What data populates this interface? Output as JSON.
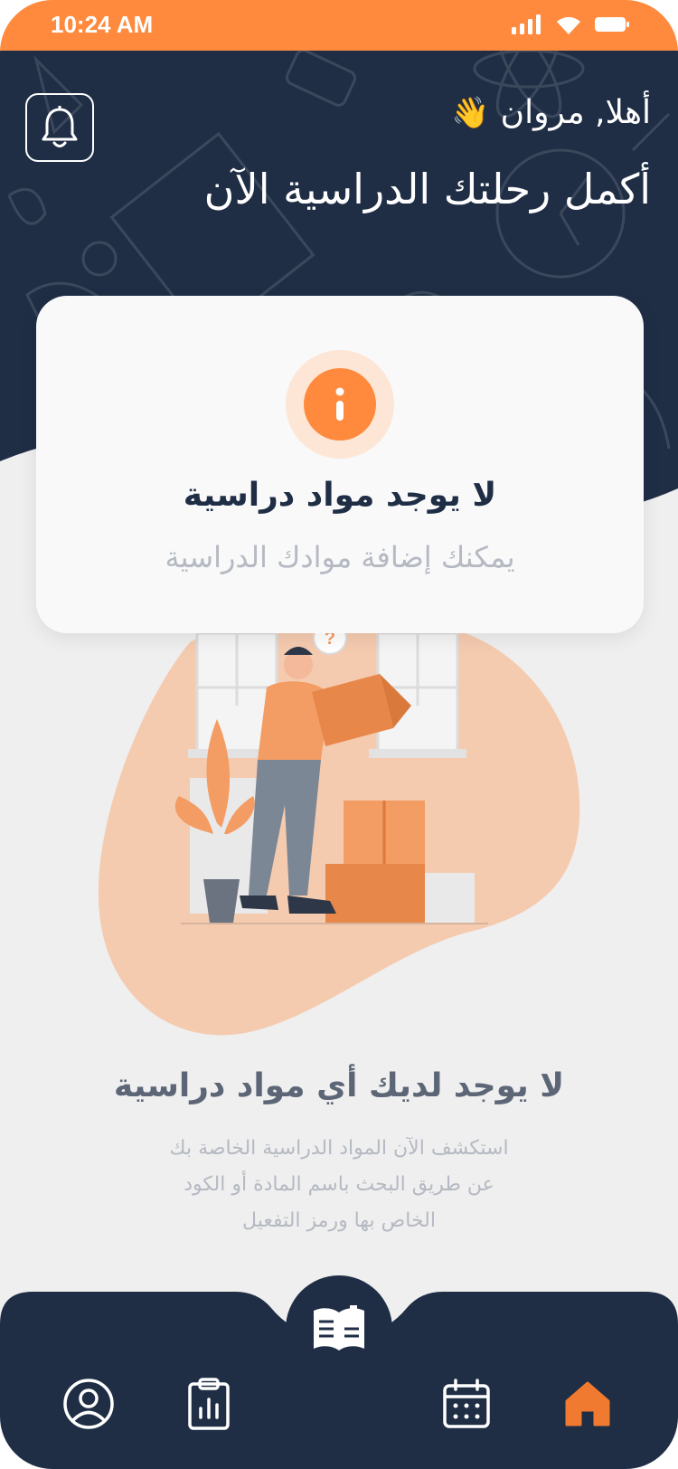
{
  "status_bar": {
    "time": "10:24 AM"
  },
  "header": {
    "greeting": "أهلا, مروان",
    "wave_emoji": "👋",
    "headline": "أكمل رحلتك الدراسية الآن"
  },
  "info_card": {
    "title": "لا يوجد مواد دراسية",
    "subtitle": "يمكنك إضافة موادك الدراسية"
  },
  "empty_state": {
    "title": "لا يوجد لديك أي مواد دراسية",
    "description_lines": [
      "استكشف الآن المواد الدراسية الخاصة بك",
      "عن طريق البحث باسم المادة أو الكود",
      "الخاص بها ورمز التفعيل"
    ]
  },
  "bottom_nav": {
    "items": [
      {
        "icon": "profile-icon",
        "active": false
      },
      {
        "icon": "report-clipboard-icon",
        "active": false
      },
      {
        "icon": "open-book-icon",
        "active": false,
        "center": true
      },
      {
        "icon": "calendar-icon",
        "active": false
      },
      {
        "icon": "home-icon",
        "active": true
      }
    ]
  },
  "colors": {
    "brand_orange": "#ff8a3d",
    "navy": "#1f2e45",
    "background": "#efefef",
    "muted_text": "#b5b9c2"
  }
}
